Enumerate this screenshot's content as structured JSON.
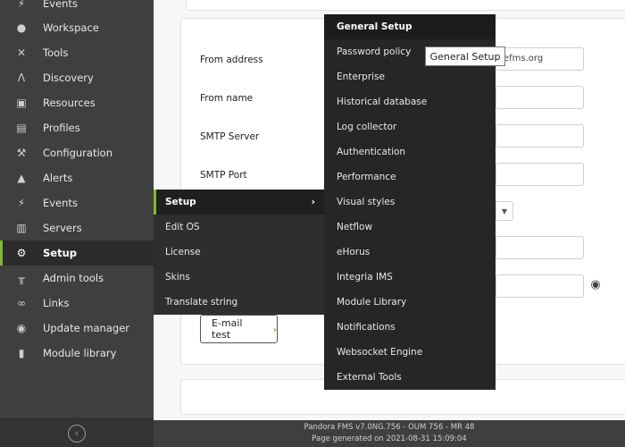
{
  "sidebar": {
    "items": [
      {
        "label": "Events",
        "icon": "bolt-icon"
      },
      {
        "label": "Workspace",
        "icon": "user-icon"
      },
      {
        "label": "Tools",
        "icon": "tools-icon"
      },
      {
        "label": "Discovery",
        "icon": "discovery-icon"
      },
      {
        "label": "Resources",
        "icon": "resources-icon"
      },
      {
        "label": "Profiles",
        "icon": "profile-icon"
      },
      {
        "label": "Configuration",
        "icon": "wrench-icon"
      },
      {
        "label": "Alerts",
        "icon": "bell-icon"
      },
      {
        "label": "Events",
        "icon": "bolt-icon"
      },
      {
        "label": "Servers",
        "icon": "server-icon"
      },
      {
        "label": "Setup",
        "icon": "gear-icon",
        "active": true
      },
      {
        "label": "Admin tools",
        "icon": "admin-tools-icon"
      },
      {
        "label": "Links",
        "icon": "link-icon"
      },
      {
        "label": "Update manager",
        "icon": "update-icon"
      },
      {
        "label": "Module library",
        "icon": "library-icon"
      }
    ]
  },
  "form": {
    "from_address_label": "From address",
    "from_address_value": "efms.org",
    "from_name_label": "From name",
    "smtp_server_label": "SMTP Server",
    "smtp_port_label": "SMTP Port",
    "email_test_label": "E-mail test"
  },
  "submenu_setup": {
    "items": [
      "Setup",
      "Edit OS",
      "License",
      "Skins",
      "Translate string"
    ]
  },
  "submenu_general": {
    "items": [
      "General Setup",
      "Password policy",
      "Enterprise",
      "Historical database",
      "Log collector",
      "Authentication",
      "Performance",
      "Visual styles",
      "Netflow",
      "eHorus",
      "Integria IMS",
      "Module Library",
      "Notifications",
      "Websocket Engine",
      "External Tools"
    ]
  },
  "tooltip": "General Setup",
  "footer": {
    "version": "Pandora FMS v7.0NG.756 - OUM 756 - MR 48",
    "generated": "Page generated on 2021-08-31 15:09:04"
  },
  "colors": {
    "accent": "#82b92e",
    "sidebar_bg": "#3f3f3f",
    "menu_bg": "#262626"
  }
}
